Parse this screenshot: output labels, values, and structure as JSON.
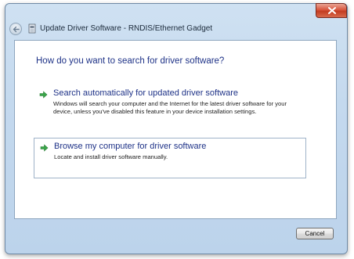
{
  "window": {
    "title": "Update Driver Software - RNDIS/Ethernet Gadget",
    "close_icon": "close-icon",
    "back_icon": "back-arrow-icon"
  },
  "content": {
    "heading": "How do you want to search for driver software?",
    "options": [
      {
        "title": "Search automatically for updated driver software",
        "description": "Windows will search your computer and the Internet for the latest driver software for your device, unless you've disabled this feature in your device installation settings.",
        "icon": "green-arrow-icon"
      },
      {
        "title": "Browse my computer for driver software",
        "description": "Locate and install driver software manually.",
        "icon": "green-arrow-icon"
      }
    ]
  },
  "footer": {
    "cancel_label": "Cancel"
  },
  "colors": {
    "heading": "#1e3287",
    "close_button": "#c33c21",
    "arrow": "#3aa64a"
  }
}
